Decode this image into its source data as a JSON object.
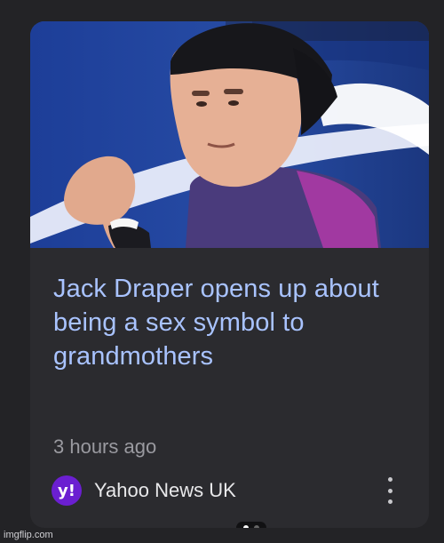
{
  "article": {
    "headline": "Jack Draper opens up about being a sex symbol to grandmothers",
    "timestamp": "3 hours ago",
    "publisher": "Yahoo News UK",
    "publisher_logo_text": "y!"
  },
  "image": {
    "description_icon": "news-photo",
    "background_color": "#23479f"
  },
  "carousel": {
    "page_count": 2,
    "active_page": 1
  },
  "watermark": {
    "text": "imgflip.com"
  },
  "colors": {
    "headline": "#a9c3ff",
    "card": "#2b2b2f",
    "logo": "#6b1fd1"
  }
}
